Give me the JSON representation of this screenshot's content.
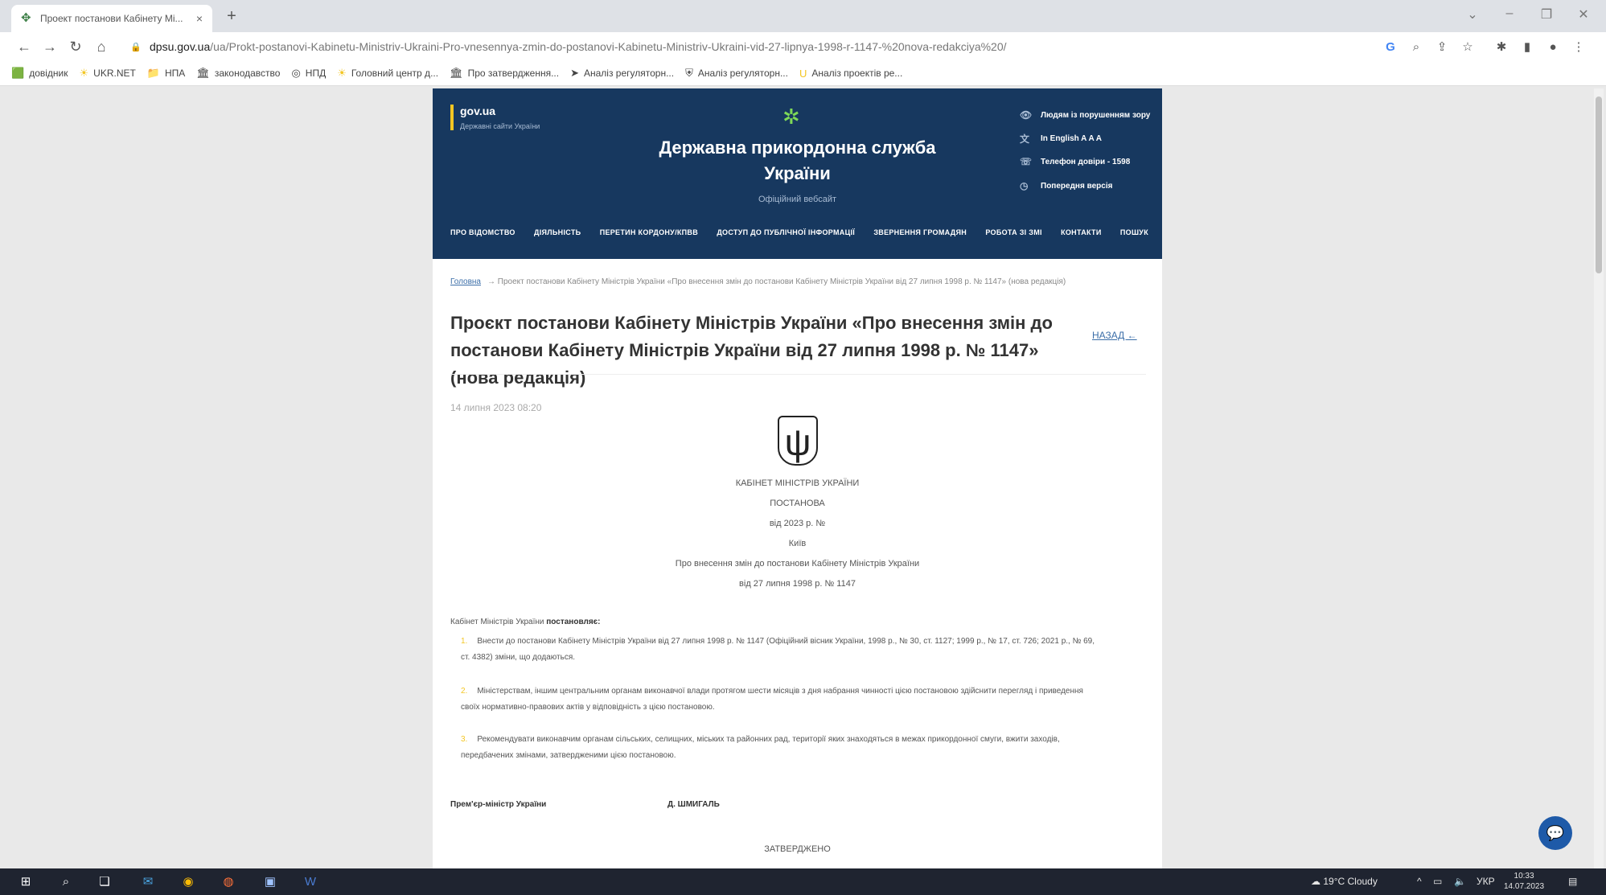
{
  "browser": {
    "tab_title": "Проект постанови Кабінету Мі...",
    "tab_close": "×",
    "new_tab": "+",
    "url_host": "dpsu.gov.ua",
    "url_path": "/ua/Prokt-postanovi-Kabinetu-Ministriv-Ukraini-Pro-vnesennya-zmin-do-postanovi-Kabinetu-Ministriv-Ukraini-vid-27-lipnya-1998-r-1147-%20nova-redakciya%20/"
  },
  "bookmarks": [
    {
      "label": "довідник",
      "icon": "🟩"
    },
    {
      "label": "UKR.NET",
      "icon": "☀"
    },
    {
      "label": "НПА",
      "icon": "📁"
    },
    {
      "label": "законодавство",
      "icon": "🏛"
    },
    {
      "label": "НПД",
      "icon": "◎"
    },
    {
      "label": "Головний центр д...",
      "icon": "☀"
    },
    {
      "label": "Про затвердження...",
      "icon": "🏛"
    },
    {
      "label": "Аналіз регуляторн...",
      "icon": "➤"
    },
    {
      "label": "Аналіз регуляторн...",
      "icon": "⛨"
    },
    {
      "label": "Аналіз проектів ре...",
      "icon": "U"
    }
  ],
  "site": {
    "govua_title": "gov.ua",
    "govua_sub": "Державні сайти України",
    "title": "Державна прикордонна служба України",
    "subtitle": "Офіційний вебсайт",
    "util": [
      {
        "label": "Людям із порушенням зору",
        "icon": "👁"
      },
      {
        "label": "In English  A  A  A",
        "icon": "文"
      },
      {
        "label": "Телефон довіри - 1598",
        "icon": "☏"
      },
      {
        "label": "Попередня версія",
        "icon": "◷"
      }
    ],
    "nav": [
      "ПРО ВІДОМСТВО",
      "ДІЯЛЬНІСТЬ",
      "ПЕРЕТИН КОРДОНУ/КПВВ",
      "ДОСТУП ДО ПУБЛІЧНОЇ ІНФОРМАЦІЇ",
      "ЗВЕРНЕННЯ ГРОМАДЯН",
      "РОБОТА ЗІ ЗМІ",
      "КОНТАКТИ",
      "ПОШУК"
    ]
  },
  "article": {
    "breadcrumb_home": "Головна",
    "breadcrumb_current": "→  Проект постанови Кабінету Міністрів України «Про внесення змін до постанови Кабінету Міністрів України від 27 липня 1998 р. № 1147» (нова редакція)",
    "title": "Проєкт постанови Кабінету Міністрів України «Про внесення змін до постанови Кабінету Міністрів України від 27 липня 1998 р. № 1147» (нова редакція)",
    "back_label": "НАЗАД ←",
    "date": "14 липня 2023 08:20",
    "cabinet": "КАБІНЕТ МІНІСТРІВ УКРАЇНИ",
    "resolution": "ПОСТАНОВА",
    "date_line": "від                          2023 р. №",
    "city": "Київ",
    "about_1": "Про внесення змін до постанови Кабінету Міністрів України",
    "about_2": "від 27 липня 1998 р. № 1147",
    "intro_plain": "Кабінет Міністрів України ",
    "intro_bold": "постановляє:",
    "paragraphs": [
      {
        "num": "1.",
        "text": "Внести до постанови Кабінету Міністрів України від 27 липня 1998 р. № 1147 (Офіційний вісник України, 1998 р., № 30, ст. 1127; 1999 р., № 17, ст. 726; 2021 р., № 69, ст. 4382) зміни, що додаються."
      },
      {
        "num": "2.",
        "text": "Міністерствам, іншим центральним органам виконавчої влади протягом шести місяців з дня набрання чинності цією постановою здійснити перегляд і приведення своїх нормативно-правових актів у відповідність з цією постановою."
      },
      {
        "num": "3.",
        "text": "Рекомендувати виконавчим органам сільських, селищних, міських та районних рад, території яких знаходяться в межах прикордонної смуги, вжити заходів, передбачених змінами, затвердженими цією постановою."
      }
    ],
    "sign_title": "Прем'єр-міністр України",
    "sign_name": "Д. ШМИГАЛЬ",
    "approved": "ЗАТВЕРДЖЕНО"
  },
  "taskbar": {
    "weather": "19°C  Cloudy",
    "lang": "УКР",
    "time": "10:33",
    "date": "14.07.2023"
  }
}
